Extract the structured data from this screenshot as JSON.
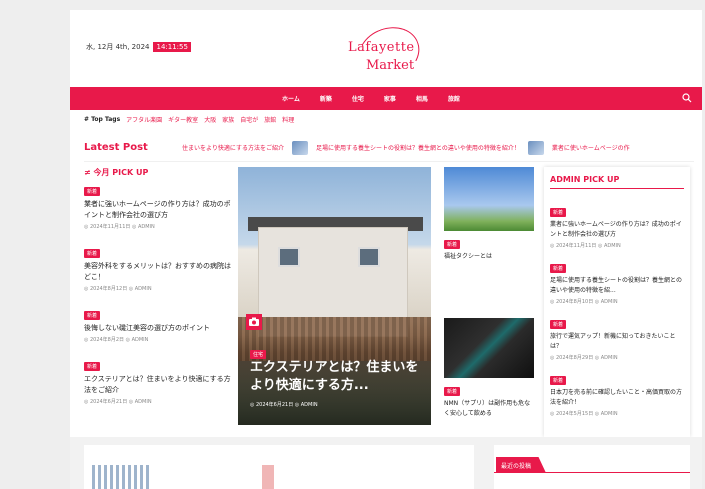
{
  "header": {
    "date": "水, 12月 4th, 2024",
    "time": "14:11:55",
    "logo_line1": "Lafayette",
    "logo_line2": "Market"
  },
  "nav": {
    "items": [
      "ホーム",
      "新築",
      "住宅",
      "家事",
      "相馬",
      "旅館"
    ]
  },
  "tags": {
    "label": "# Top Tags",
    "items": [
      "アフタル楽園",
      "ギター教室",
      "大阪",
      "家族",
      "自宅が",
      "旅館",
      "料理"
    ]
  },
  "latest": {
    "title": "Latest Post",
    "items": [
      "住まいをより快適にする方法をご紹介",
      "足場に使用する養生シートの役割は？養生網との違いや使用の特徴を紹介！",
      "業者に使いホームページの作"
    ]
  },
  "left": {
    "title": "≠ 今月 PICK UP",
    "posts": [
      {
        "badge": "新着",
        "title": "業者に強いホームページの作り方は？成功のポイントと制作会社の選び方",
        "meta": "◎ 2024年11月11日 ◎ ADMIN"
      },
      {
        "badge": "新着",
        "title": "美容外科をするメリットは？おすすめの病院はどこ！",
        "meta": "◎ 2024年8月12日 ◎ ADMIN"
      },
      {
        "badge": "新着",
        "title": "後悔しない磯江美容の選び方のポイント",
        "meta": "◎ 2024年8月2日 ◎ ADMIN"
      },
      {
        "badge": "新着",
        "title": "エクステリアとは？住まいをより快適にする方法をご紹介",
        "meta": "◎ 2024年6月21日 ◎ ADMIN"
      }
    ]
  },
  "hero": {
    "badge": "住宅",
    "title": "エクステリアとは？住まいをより快適にする方...",
    "meta": "◎ 2024年6月21日 ◎ ADMIN"
  },
  "mid": {
    "posts": [
      {
        "badge": "新着",
        "title": "福祉タクシーとは"
      },
      {
        "badge": "新着",
        "title": "NMN（サプリ）は副作用も危なく安心して飲める"
      }
    ]
  },
  "right": {
    "title": "ADMIN PICK UP",
    "posts": [
      {
        "badge": "新着",
        "title": "業者に強いホームページの作り方は？成功のポイントと制作会社の選び方",
        "meta": "◎ 2024年11月11日 ◎ ADMIN"
      },
      {
        "badge": "新着",
        "title": "足場に使用する養生シートの役割は？養生網との違いや使用の特徴を紹...",
        "meta": "◎ 2024年8月10日 ◎ ADMIN"
      },
      {
        "badge": "新着",
        "title": "旅行で運気アップ！新機に知っておきたいことは？",
        "meta": "◎ 2024年8月29日 ◎ ADMIN"
      },
      {
        "badge": "新着",
        "title": "日本刀を売る前に確認したいこと・高価買取の方法を紹介！",
        "meta": "◎ 2024年5月15日 ◎ ADMIN"
      }
    ]
  },
  "bottom": {
    "tab_label": "最近の投稿"
  },
  "colors": {
    "accent": "#e8194a"
  }
}
